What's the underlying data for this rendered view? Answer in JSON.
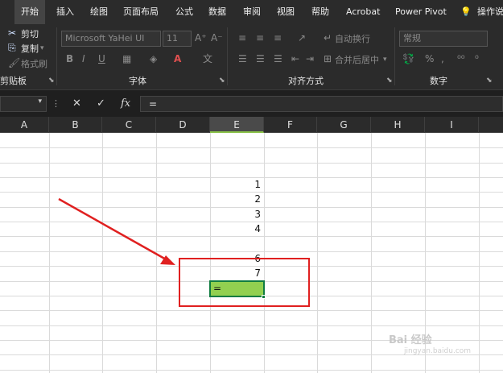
{
  "ribbon": {
    "tabs": [
      "开始",
      "插入",
      "绘图",
      "页面布局",
      "公式",
      "数据",
      "审阅",
      "视图",
      "帮助",
      "Acrobat",
      "Power Pivot",
      "操作说明"
    ],
    "clipboard": {
      "cut": "剪切",
      "copy": "复制",
      "format_painter": "格式刷",
      "label": "剪贴板"
    },
    "font": {
      "family": "Microsoft YaHei UI",
      "size": "11",
      "label": "字体",
      "bold": "B",
      "italic": "I",
      "underline": "U"
    },
    "alignment": {
      "wrap": "自动换行",
      "merge": "合并后居中",
      "label": "对齐方式"
    },
    "number": {
      "format": "常规",
      "label": "数字"
    }
  },
  "formula_bar": {
    "cancel": "✕",
    "enter": "✓",
    "fx": "fx",
    "content": "="
  },
  "columns": [
    "A",
    "B",
    "C",
    "D",
    "E",
    "F",
    "G",
    "H",
    "I"
  ],
  "cells": {
    "e1": "1",
    "e2": "2",
    "e3": "3",
    "e4": "4",
    "e6": "6",
    "e7": "7",
    "active": "="
  },
  "watermark": {
    "brand": "Bai 经验",
    "sub": "jingyan.baidu.com"
  },
  "colors": {
    "active_fill": "#92d050",
    "active_border": "#107c41",
    "annotation": "#e02020"
  }
}
